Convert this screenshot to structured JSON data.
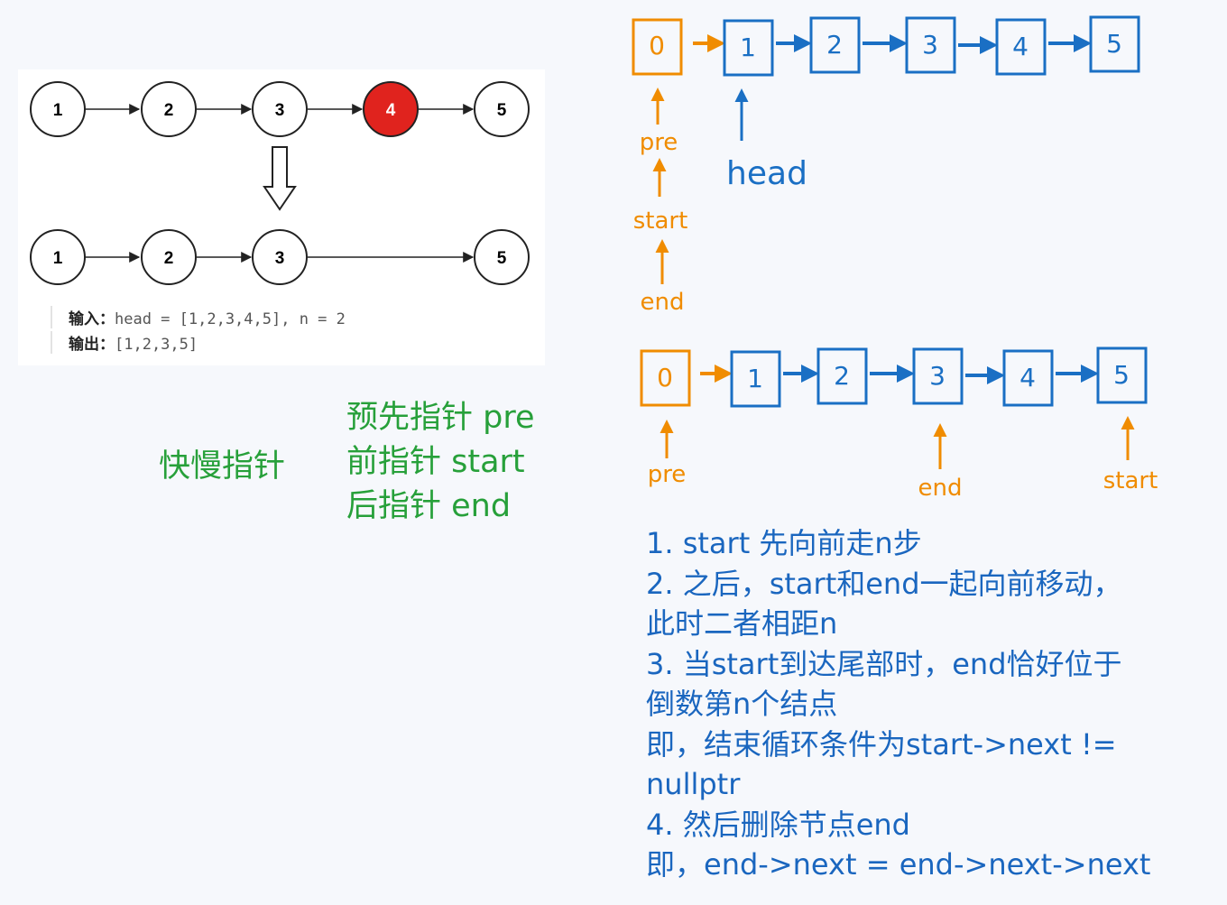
{
  "example": {
    "list_before": [
      "1",
      "2",
      "3",
      "4",
      "5"
    ],
    "list_after": [
      "1",
      "2",
      "3",
      "5"
    ],
    "input_label": "输入：",
    "input_value": "head = [1,2,3,4,5], n = 2",
    "output_label": "输出：",
    "output_value": "[1,2,3,5]",
    "highlight_color": "#e0231e"
  },
  "labels": {
    "fast_slow": "快慢指针",
    "pre_pointer": "预先指针 pre",
    "front_pointer": "前指针 start",
    "back_pointer": "后指针 end"
  },
  "diagram_top": {
    "dummy": "0",
    "nodes": [
      "1",
      "2",
      "3",
      "4",
      "5"
    ],
    "pointers": {
      "pre": "pre",
      "start": "start",
      "end": "end",
      "head": "head"
    }
  },
  "diagram_bottom": {
    "dummy": "0",
    "nodes": [
      "1",
      "2",
      "3",
      "4",
      "5"
    ],
    "pointers": {
      "pre": "pre",
      "end": "end",
      "start": "start"
    }
  },
  "steps": [
    "1. start 先向前走n步",
    "2. 之后，start和end一起向前移动，",
    "此时二者相距n",
    "3. 当start到达尾部时，end恰好位于",
    "倒数第n个结点",
    "即，结束循环条件为start->next !=",
    "nullptr",
    "4. 然后删除节点end",
    "即，end->next = end->next->next"
  ],
  "colors": {
    "orange": "#f08c00",
    "blue": "#1a6fc4",
    "green": "#27a03a"
  }
}
